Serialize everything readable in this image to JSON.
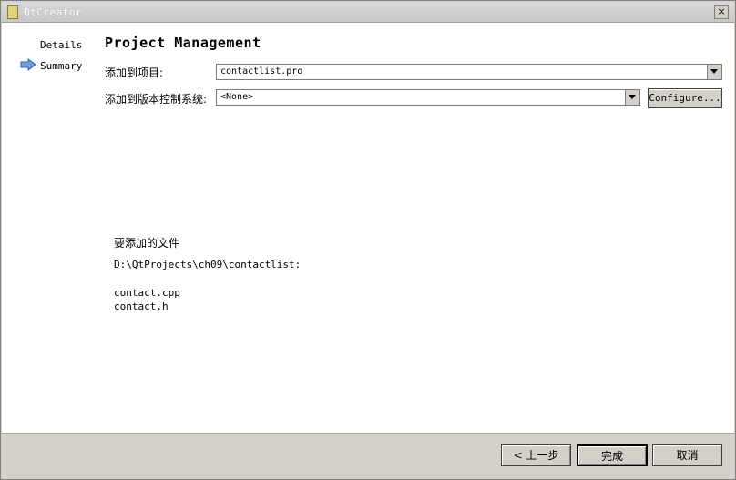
{
  "window": {
    "title": "QtCreator",
    "close_symbol": "×"
  },
  "sidebar": {
    "items": [
      {
        "label": "Details"
      },
      {
        "label": "Summary",
        "active": true
      }
    ]
  },
  "main": {
    "title": "Project Management",
    "add_to_project_label": "添加到项目:",
    "add_to_project_value": "contactlist.pro",
    "add_to_vcs_label": "添加到版本控制系统:",
    "add_to_vcs_value": "<None>",
    "configure_label": "Configure...",
    "files_heading": "要添加的文件",
    "files_dir": "D:\\QtProjects\\ch09\\contactlist:",
    "files": [
      "contact.cpp",
      "contact.h"
    ]
  },
  "footer": {
    "back_label": "< 上一步",
    "finish_label": "完成",
    "cancel_label": "取消"
  },
  "colors": {
    "window_bg": "#d4d0c8",
    "content_bg": "#ffffff",
    "arrow": "#4a86d4"
  },
  "icons": {
    "app": "folder-icon",
    "current_step": "arrow-right-icon"
  }
}
